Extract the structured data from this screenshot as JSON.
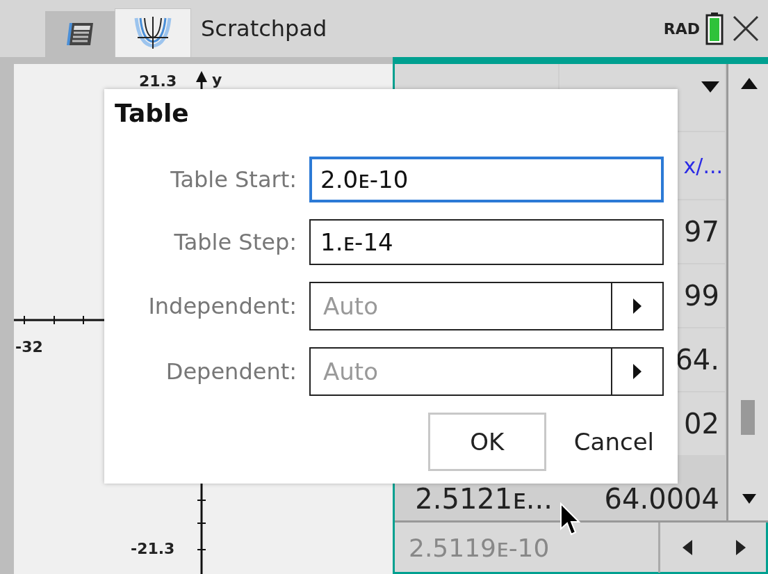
{
  "tabs": [
    {
      "kind": "calculator",
      "selected": false
    },
    {
      "kind": "graph",
      "selected": true
    }
  ],
  "app_title": "Scratchpad",
  "angle_mode": "RAD",
  "graph": {
    "y_max": "21.3",
    "y_axis_label": "y",
    "x_min": "-32",
    "y_min": "-21.3"
  },
  "table": {
    "formula_cell": "x/...",
    "rows": [
      {
        "column_2": "97"
      },
      {
        "column_2": "99"
      },
      {
        "column_2": "64."
      },
      {
        "column_2": "02"
      },
      {
        "column_1": "2.5121ᴇ...",
        "column_2": "64.0004"
      }
    ],
    "entry_line": "2.5119ᴇ-10"
  },
  "dialog": {
    "title": "Table",
    "fields": [
      {
        "kind": "text",
        "label": "Table Start:",
        "value": "2.0ᴇ-10",
        "focused": true
      },
      {
        "kind": "text",
        "label": "Table Step:",
        "value": "1.ᴇ-14",
        "focused": false
      },
      {
        "kind": "dropdown",
        "label": "Independent:",
        "value": "Auto"
      },
      {
        "kind": "dropdown",
        "label": "Dependent:",
        "value": "Auto"
      }
    ],
    "buttons": [
      {
        "kind": "boxed",
        "label": "OK"
      },
      {
        "kind": "plain",
        "label": "Cancel"
      }
    ]
  }
}
